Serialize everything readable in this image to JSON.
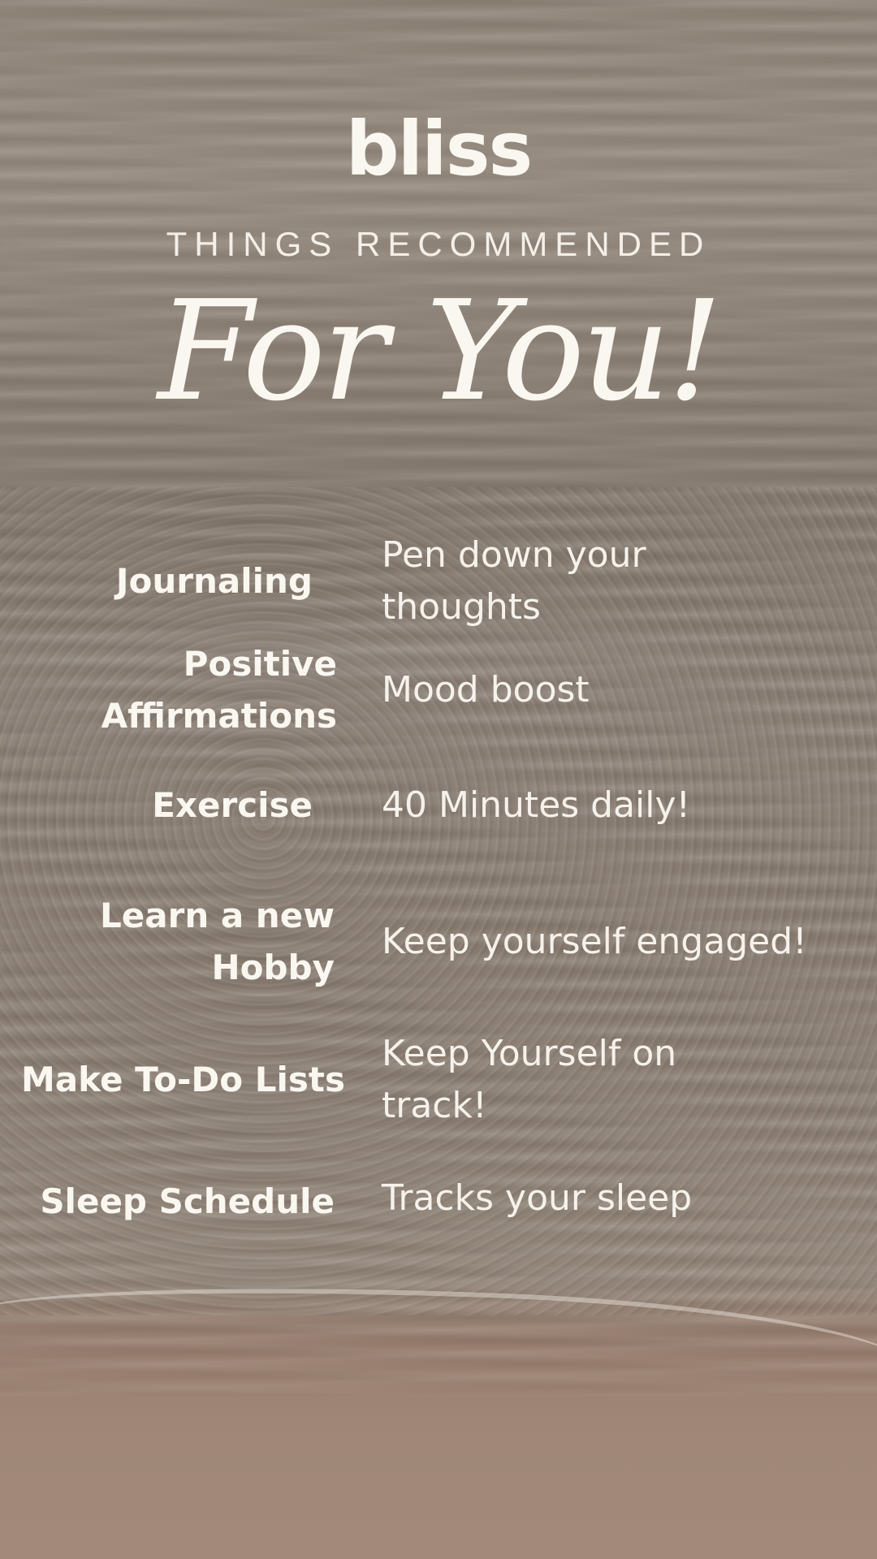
{
  "brand": {
    "logo": "bliss"
  },
  "header": {
    "subtitle": "THINGS RECOMMENDED",
    "headline": "For You!"
  },
  "recommendations": [
    {
      "name": "Journaling",
      "description": "Pen down your thoughts"
    },
    {
      "name": "Positive Affirmations",
      "description": "Mood boost"
    },
    {
      "name": "Exercise",
      "description": "40 Minutes daily!"
    },
    {
      "name": "Learn a new Hobby",
      "description": "Keep yourself engaged!"
    },
    {
      "name": "Make To-Do Lists",
      "description": "Keep Yourself on track!"
    },
    {
      "name": "Sleep Schedule",
      "description": "Tracks your sleep"
    }
  ],
  "colors": {
    "text": "#faf7f0",
    "background": "#8c8177",
    "sand": "#a2897a"
  }
}
